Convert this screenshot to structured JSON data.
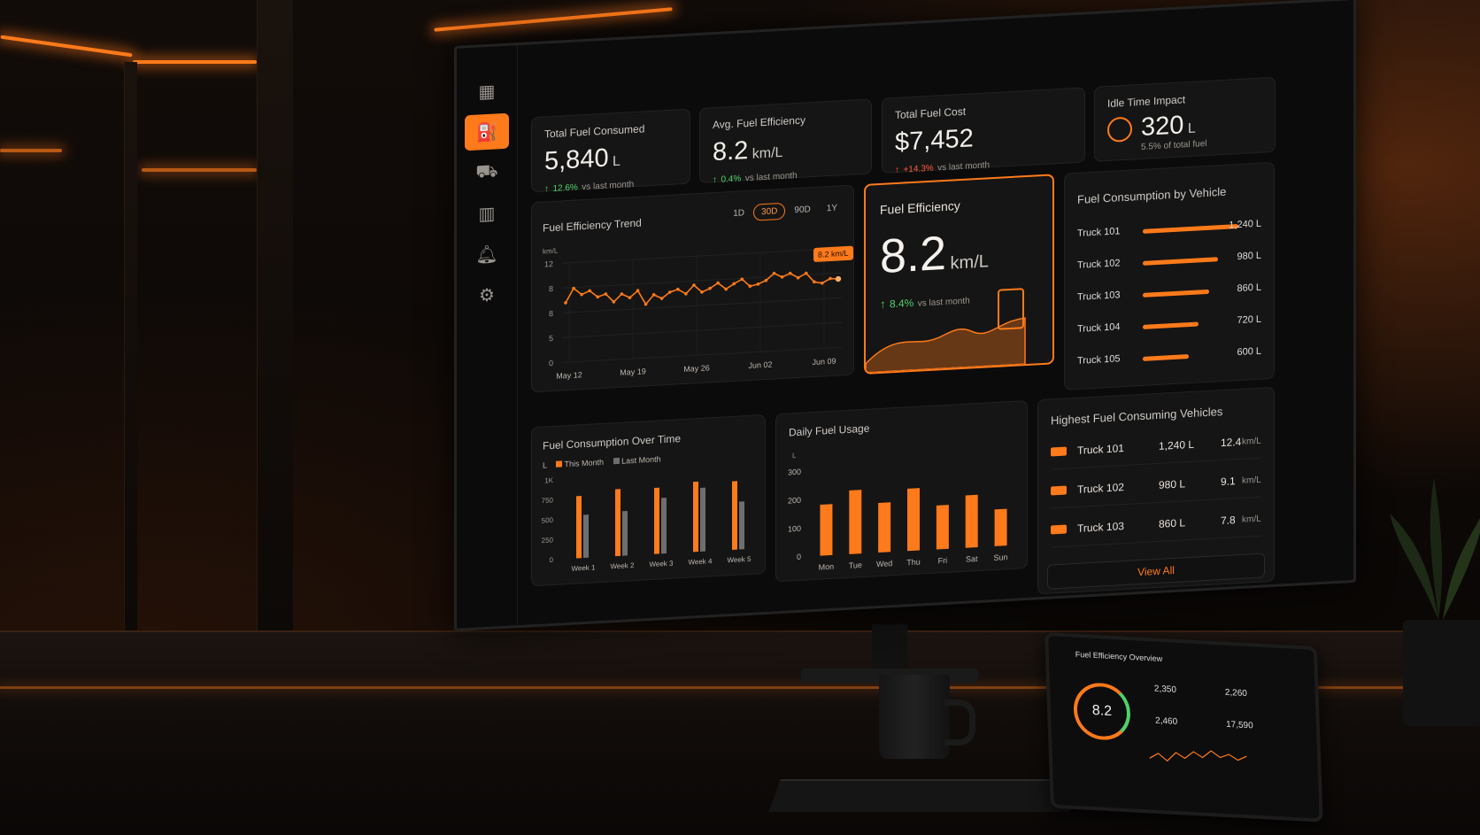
{
  "kpis": {
    "total_fuel": {
      "label": "Total Fuel Consumed",
      "value": "5,840",
      "unit": "L",
      "delta": "12.6%",
      "delta_suffix": "vs last month"
    },
    "avg_eff": {
      "label": "Avg. Fuel Efficiency",
      "value": "8.2",
      "unit": "km/L",
      "delta": "0.4%",
      "delta_suffix": "vs last month"
    },
    "fuel_cost": {
      "label": "Total Fuel Cost",
      "value": "$7,452",
      "delta": "+14.3%",
      "delta_suffix": "vs last month"
    },
    "idle": {
      "label": "Idle Time Impact",
      "value": "320",
      "unit": "L",
      "sub": "5.5% of total fuel"
    }
  },
  "trend": {
    "title": "Fuel Efficiency Trend",
    "ranges": [
      "1D",
      "30D",
      "90D",
      "1Y"
    ],
    "selected_range": "30D",
    "badge": "8.2 km/L"
  },
  "efficiency_card": {
    "title": "Fuel Efficiency",
    "value": "8.2",
    "unit": "km/L",
    "delta": "8.4%",
    "delta_suffix": "vs last month"
  },
  "by_vehicle": {
    "title": "Fuel Consumption by Vehicle"
  },
  "over_time": {
    "title": "Fuel Consumption Over Time",
    "legend_unit": "L"
  },
  "daily": {
    "title": "Daily Fuel Usage"
  },
  "highest": {
    "title": "Highest Fuel Consuming Vehicles",
    "rows": [
      {
        "name": "Truck 101",
        "fuel": "1,240 L",
        "eff": "12.4",
        "eff_unit": "km/L"
      },
      {
        "name": "Truck 102",
        "fuel": "980 L",
        "eff": "9.1",
        "eff_unit": "km/L"
      },
      {
        "name": "Truck 103",
        "fuel": "860 L",
        "eff": "7.8",
        "eff_unit": "km/L"
      }
    ],
    "view_all": "View All"
  },
  "tablet": {
    "title": "Fuel Efficiency Overview",
    "gauge": "8.2",
    "stats": [
      "2,350",
      "2,260",
      "2,460",
      "17,590"
    ]
  },
  "icons": {
    "nav": [
      "grid-icon",
      "fuel-pump-icon",
      "truck-icon",
      "bar-chart-icon",
      "bell-icon",
      "gear-icon"
    ]
  },
  "colors": {
    "accent": "#ff7a1a",
    "up": "#4fd16b",
    "down": "#ff5a3a",
    "secondary_bar": "#6e6e6e"
  },
  "chart_data": [
    {
      "type": "line",
      "title": "Fuel Efficiency Trend",
      "ylabel": "km/L",
      "yticks": [
        "0",
        "5",
        "8",
        "8",
        "12"
      ],
      "ylim": [
        0,
        12
      ],
      "xticks": [
        "May 12",
        "May 19",
        "May 26",
        "Jun 02",
        "Jun 09"
      ],
      "grid": true,
      "values": [
        7.2,
        8.9,
        8.1,
        8.5,
        7.7,
        8.0,
        7.0,
        7.9,
        7.4,
        8.2,
        6.5,
        7.6,
        7.1,
        7.8,
        8.1,
        7.5,
        8.5,
        7.6,
        8.0,
        8.6,
        7.8,
        8.4,
        8.9,
        8.0,
        8.2,
        8.6,
        9.4,
        8.9,
        9.3,
        8.7,
        9.2,
        8.1,
        7.9,
        8.4,
        8.3
      ]
    },
    {
      "type": "bar",
      "title": "Fuel Consumption by Vehicle",
      "categories": [
        "Truck 101",
        "Truck 102",
        "Truck 103",
        "Truck 104",
        "Truck 105"
      ],
      "values": [
        1240,
        980,
        860,
        720,
        600
      ],
      "value_labels": [
        "1,240 L",
        "980 L",
        "860 L",
        "720 L",
        "600 L"
      ],
      "orientation": "horizontal"
    },
    {
      "type": "bar",
      "title": "Fuel Consumption Over Time",
      "categories": [
        "Week 1",
        "Week 2",
        "Week 3",
        "Week 4",
        "Week 5"
      ],
      "yticks": [
        "0",
        "250",
        "500",
        "750",
        "1K"
      ],
      "ylim": [
        0,
        1000
      ],
      "series": [
        {
          "name": "This Month",
          "values": [
            780,
            840,
            830,
            880,
            860
          ]
        },
        {
          "name": "Last Month",
          "values": [
            540,
            560,
            700,
            800,
            600
          ]
        }
      ],
      "legend": "top-left"
    },
    {
      "type": "bar",
      "title": "Daily Fuel Usage",
      "ylabel": "L",
      "yticks": [
        "0",
        "100",
        "200",
        "300"
      ],
      "ylim": [
        0,
        300
      ],
      "categories": [
        "Mon",
        "Tue",
        "Wed",
        "Thu",
        "Fri",
        "Sat",
        "Sun"
      ],
      "values": [
        180,
        225,
        175,
        220,
        155,
        185,
        130
      ]
    }
  ]
}
